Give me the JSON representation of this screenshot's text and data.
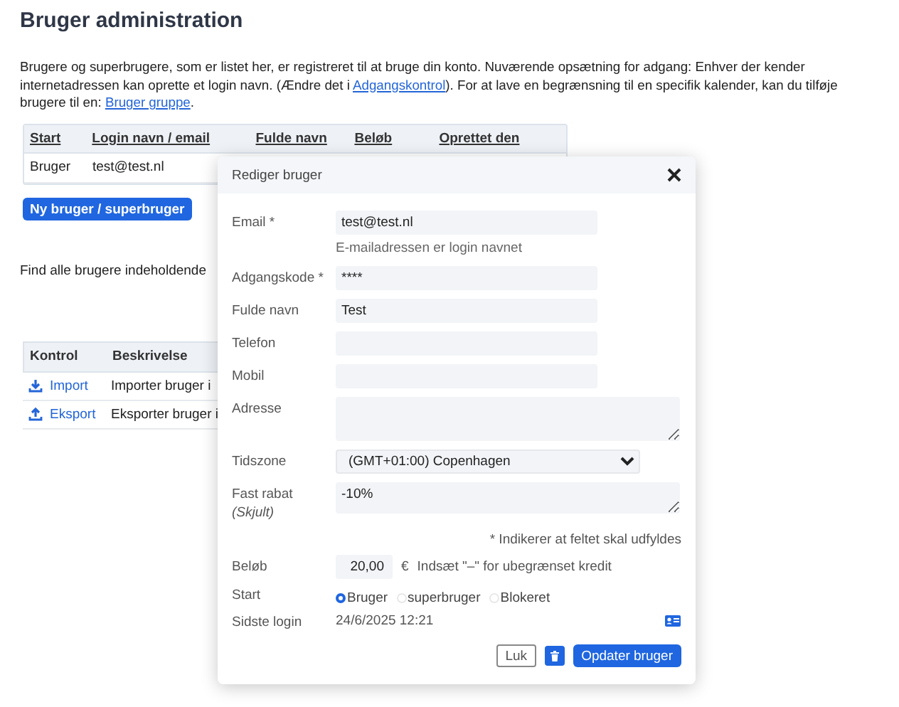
{
  "page": {
    "title": "Bruger administration",
    "intro": [
      {
        "kind": "text",
        "text": "Brugere og superbrugere, som er listet her, er registreret til at bruge din konto. Nuværende opsætning for adgang: Enhver der kender internetadressen kan oprette et login navn. (Ændre det i "
      },
      {
        "kind": "link",
        "text": "Adgangskontrol"
      },
      {
        "kind": "text",
        "text": "). For at lave en begrænsning til en specifik kalender, kan du tilføje brugere til en: "
      },
      {
        "kind": "link",
        "text": "Bruger gruppe"
      },
      {
        "kind": "text",
        "text": "."
      }
    ],
    "users_table": {
      "columns": [
        "Start",
        "Login navn / email",
        "Fulde navn",
        "Beløb",
        "Oprettet den"
      ],
      "rows": [
        {
          "start": "Bruger",
          "login": "test@test.nl"
        }
      ]
    },
    "new_user_button": "Ny bruger / superbruger",
    "search_label": "Find alle brugere indeholdende",
    "controls_table": {
      "columns": [
        "Kontrol",
        "Beskrivelse"
      ],
      "rows": [
        {
          "kind": "import",
          "label": "Import",
          "description": "Importer bruger i"
        },
        {
          "kind": "export",
          "label": "Eksport",
          "description": "Eksporter bruger i"
        }
      ]
    }
  },
  "dialog": {
    "title": "Rediger bruger",
    "fields": [
      {
        "kind": "input",
        "label": "Email *",
        "value": "test@test.nl",
        "hint": "E-mailadressen er login navnet"
      },
      {
        "kind": "input",
        "label": "Adgangskode *",
        "value": "****"
      },
      {
        "kind": "input",
        "label": "Fulde navn",
        "value": "Test"
      },
      {
        "kind": "input",
        "label": "Telefon"
      },
      {
        "kind": "input",
        "label": "Mobil"
      },
      {
        "kind": "textarea",
        "label": "Adresse"
      },
      {
        "kind": "select",
        "label": "Tidszone",
        "value": "(GMT+01:00) Copenhagen"
      },
      {
        "kind": "textarea",
        "label": "Fast rabat",
        "sublabel": "(Skjult)",
        "value": "-10%"
      }
    ],
    "required_note": "* Indikerer at feltet skal udfyldes",
    "amount": {
      "label": "Beløb",
      "value": "20,00",
      "currency": "€",
      "hint": "Indsæt \"–\" for ubegrænset kredit"
    },
    "start": {
      "label": "Start",
      "options": [
        {
          "label": "Bruger",
          "selected": true
        },
        {
          "label": "superbruger",
          "selected": false
        },
        {
          "label": "Blokeret",
          "selected": false
        }
      ]
    },
    "last_login": {
      "label": "Sidste login",
      "value": "24/6/2025 12:21"
    },
    "close_button": "Luk",
    "update_button": "Opdater bruger"
  }
}
